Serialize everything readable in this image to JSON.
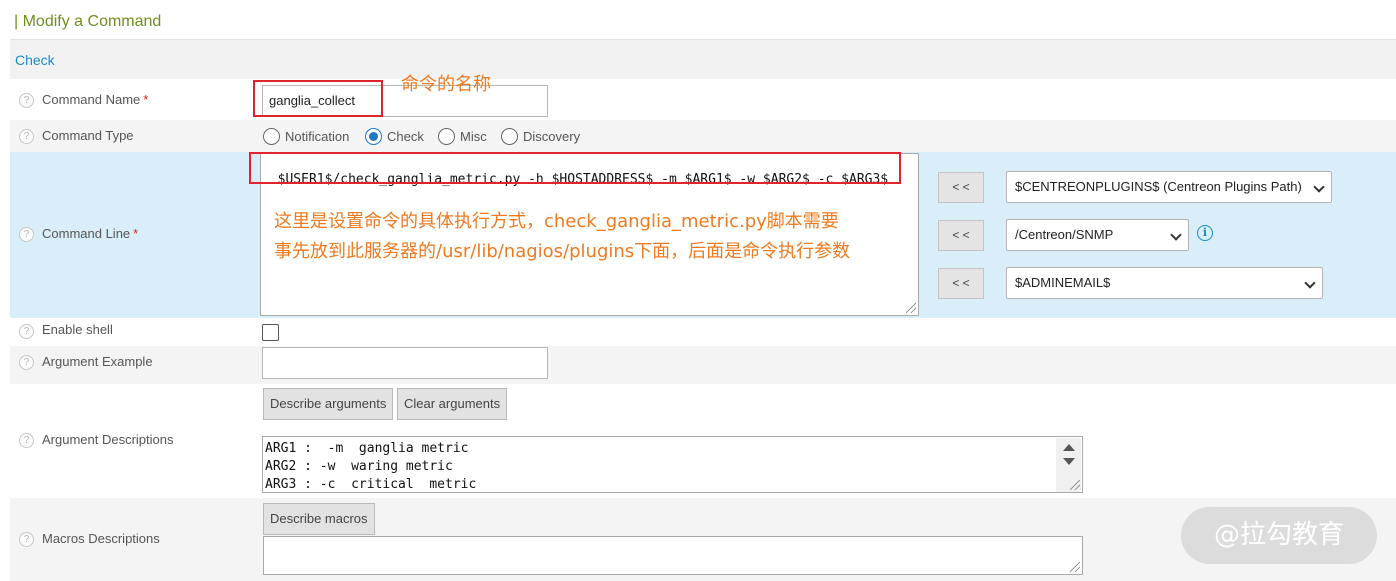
{
  "page_title": "| Modify a Command",
  "section_title": "Check",
  "help_glyph": "?",
  "fields": {
    "command_name": {
      "label": "Command Name",
      "required": "*",
      "value": "ganglia_collect"
    },
    "command_type": {
      "label": "Command Type",
      "options": [
        "Notification",
        "Check",
        "Misc",
        "Discovery"
      ],
      "selected": "Check"
    },
    "command_line": {
      "label": "Command Line",
      "required": "*",
      "value": "$USER1$/check_ganglia_metric.py -h $HOSTADDRESS$ -m $ARG1$ -w $ARG2$ -c $ARG3$"
    },
    "enable_shell": {
      "label": "Enable shell",
      "checked": false
    },
    "argument_example": {
      "label": "Argument Example",
      "value": ""
    },
    "argument_descriptions": {
      "label": "Argument Descriptions",
      "describe_button": "Describe arguments",
      "clear_button": "Clear arguments",
      "lines": [
        "ARG1 :  -m  ganglia metric",
        "ARG2 : -w  waring metric",
        "ARG3 : -c  critical  metric"
      ]
    },
    "macros_descriptions": {
      "label": "Macros Descriptions",
      "describe_button": "Describe macros",
      "value": ""
    }
  },
  "macro_pickers": [
    {
      "insert_label": "< <",
      "selected": "$CENTREONPLUGINS$ (Centreon Plugins Path)"
    },
    {
      "insert_label": "< <",
      "selected": "/Centreon/SNMP",
      "info": "i"
    },
    {
      "insert_label": "< <",
      "selected": "$ADMINEMAIL$"
    }
  ],
  "annotations": {
    "name_note": "命令的名称",
    "line_note_1": "这里是设置命令的具体执行方式，check_ganglia_metric.py脚本需要",
    "line_note_2": "事先放到此服务器的/usr/lib/nagios/plugins下面，后面是命令执行参数"
  },
  "watermark": "@拉勾教育",
  "colors": {
    "title_green": "#6e8f1f",
    "link_blue": "#1a8bc9",
    "annotation_orange": "#f07a1f",
    "highlight_red": "#e0242c",
    "row_blue": "#d9eef8"
  }
}
